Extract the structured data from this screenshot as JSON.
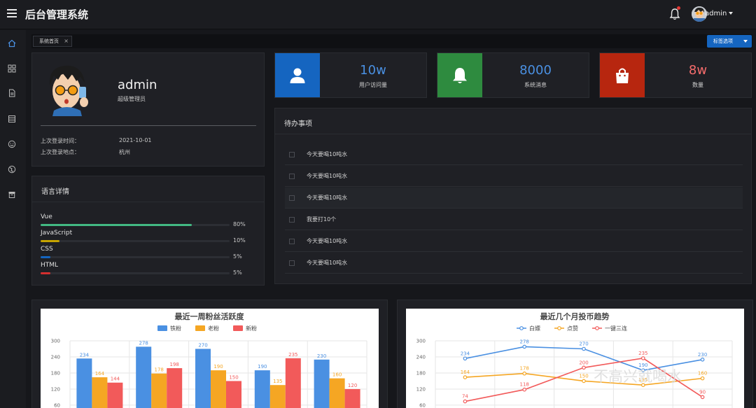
{
  "app": {
    "title": "后台管理系统"
  },
  "header": {
    "username": "admin"
  },
  "sidebar": {
    "items": [
      "home-icon",
      "grid-icon",
      "document-icon",
      "table-icon",
      "smile-icon",
      "globe-icon",
      "archive-icon"
    ]
  },
  "tabs": {
    "items": [
      {
        "label": "系统首页"
      }
    ],
    "options_label": "标签选项"
  },
  "profile": {
    "name": "admin",
    "role": "超级管理员",
    "last_login_time_label": "上次登录时间：",
    "last_login_time": "2021-10-01",
    "last_login_place_label": "上次登录地点：",
    "last_login_place": "杭州"
  },
  "languages": {
    "title": "语言详情",
    "items": [
      {
        "name": "Vue",
        "percent": 80,
        "percent_text": "80%",
        "color": "#42b983"
      },
      {
        "name": "JavaScript",
        "percent": 10,
        "percent_text": "10%",
        "color": "#c6a400"
      },
      {
        "name": "CSS",
        "percent": 5,
        "percent_text": "5%",
        "color": "#1565c0"
      },
      {
        "name": "HTML",
        "percent": 5,
        "percent_text": "5%",
        "color": "#d32f2f"
      }
    ]
  },
  "stats": [
    {
      "value": "10w",
      "label": "用户访问量",
      "icon": "user-icon",
      "color": "#1565c0",
      "value_color": "#4a90e2"
    },
    {
      "value": "8000",
      "label": "系统消息",
      "icon": "bell-icon",
      "color": "#2e8b3f",
      "value_color": "#4a90e2"
    },
    {
      "value": "8w",
      "label": "数量",
      "icon": "shopping-bag-icon",
      "color": "#b7260f",
      "value_color": "#f56c6c"
    }
  ],
  "todo": {
    "title": "待办事项",
    "items": [
      {
        "text": "今天要喝10吨水"
      },
      {
        "text": "今天要喝10吨水"
      },
      {
        "text": "今天要喝10吨水"
      },
      {
        "text": "我要打10个"
      },
      {
        "text": "今天要喝10吨水"
      },
      {
        "text": "今天要喝10吨水"
      }
    ]
  },
  "watermark": "不高兴就喝水",
  "chart_data": [
    {
      "type": "bar",
      "title": "最近一周粉丝活跃度",
      "series": [
        {
          "name": "铁粉",
          "color": "#4a90e2",
          "values": [
            234,
            278,
            270,
            190,
            230
          ]
        },
        {
          "name": "老粉",
          "color": "#f5a623",
          "values": [
            164,
            178,
            190,
            135,
            160
          ]
        },
        {
          "name": "新粉",
          "color": "#f25a5a",
          "values": [
            144,
            198,
            150,
            235,
            120
          ]
        }
      ],
      "yticks": [
        60,
        120,
        180,
        240,
        300
      ],
      "ylim": [
        0,
        300
      ],
      "legend": "top"
    },
    {
      "type": "line",
      "title": "最近几个月投币趋势",
      "series": [
        {
          "name": "白嫖",
          "color": "#4a90e2",
          "values": [
            234,
            278,
            270,
            190,
            230
          ]
        },
        {
          "name": "点赞",
          "color": "#f5a623",
          "values": [
            164,
            178,
            150,
            135,
            160
          ]
        },
        {
          "name": "一键三连",
          "color": "#f25a5a",
          "values": [
            74,
            118,
            200,
            235,
            90
          ]
        }
      ],
      "yticks": [
        60,
        120,
        180,
        240,
        300
      ],
      "ylim": [
        0,
        300
      ],
      "legend": "top"
    }
  ]
}
